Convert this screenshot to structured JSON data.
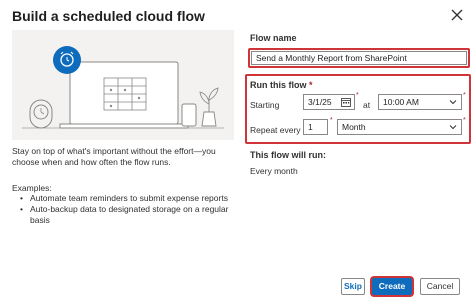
{
  "dialog": {
    "title": "Build a scheduled cloud flow",
    "close_icon": "close-icon"
  },
  "left": {
    "description": "Stay on top of what's important without the effort—you choose when and how often the flow runs.",
    "examples_title": "Examples:",
    "examples": [
      "Automate team reminders to submit expense reports",
      "Auto-backup data to designated storage on a regular basis"
    ]
  },
  "form": {
    "flow_name_label": "Flow name",
    "flow_name_value": "Send a Monthly Report from SharePoint",
    "run_label": "Run this flow",
    "required_mark": "*",
    "starting_label": "Starting",
    "start_date": "3/1/25",
    "at_label": "at",
    "start_time": "10:00 AM",
    "repeat_label": "Repeat every",
    "repeat_count": "1",
    "repeat_unit": "Month",
    "result_label": "This flow will run:",
    "result_value": "Every month"
  },
  "buttons": {
    "skip": "Skip",
    "create": "Create",
    "cancel": "Cancel"
  },
  "colors": {
    "accent": "#0f6cbd",
    "highlight": "#d13438"
  }
}
